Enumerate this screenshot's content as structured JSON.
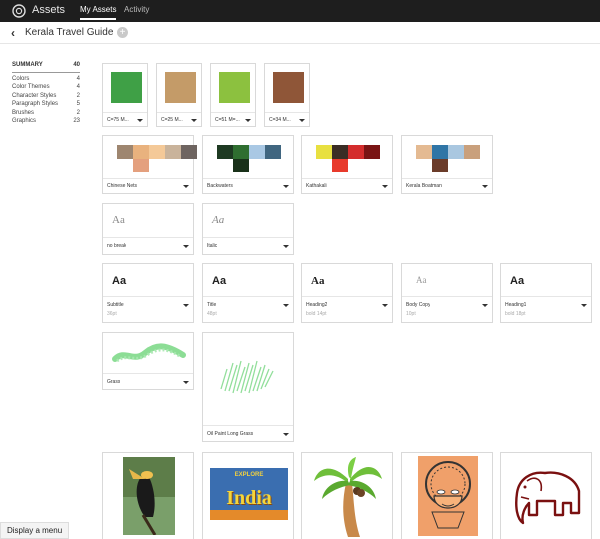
{
  "app": {
    "brand": "Assets",
    "nav_active": "My Assets",
    "nav_other": "Activity"
  },
  "library": {
    "title": "Kerala Travel Guide",
    "add_label": "+"
  },
  "sidebar": {
    "summary_label": "SUMMARY",
    "summary_count": "40",
    "items": [
      {
        "label": "Colors",
        "count": "4"
      },
      {
        "label": "Color Themes",
        "count": "4"
      },
      {
        "label": "Character Styles",
        "count": "2"
      },
      {
        "label": "Paragraph Styles",
        "count": "5"
      },
      {
        "label": "Brushes",
        "count": "2"
      },
      {
        "label": "Graphics",
        "count": "23"
      }
    ]
  },
  "colors": [
    {
      "label": "C=75 M...",
      "hex": "#3fa046"
    },
    {
      "label": "C=25 M...",
      "hex": "#c49b68"
    },
    {
      "label": "C=51 M=...",
      "hex": "#8cc13f"
    },
    {
      "label": "C=34 M...",
      "hex": "#8f5638"
    }
  ],
  "themes": [
    {
      "label": "Chinese Nets",
      "colors": [
        "#9e8670",
        "#e9b27e",
        "#f4c998",
        "#c9b39b",
        "#6e6460"
      ],
      "accent": "#e4a07e"
    },
    {
      "label": "Backwaters",
      "colors": [
        "#1e3a22",
        "#2f6e30",
        "#a9c8e4",
        "#406680"
      ],
      "accent": "#193119"
    },
    {
      "label": "Kathakali",
      "colors": [
        "#e8e040",
        "#3a2d25",
        "#d42d2d",
        "#7a1414"
      ],
      "accent": "#e83a2c"
    },
    {
      "label": "Kerala Boatman",
      "colors": [
        "#e4ba92",
        "#2f75a6",
        "#a9c7e0",
        "#c9a07c"
      ],
      "accent": "#6b3c2a"
    }
  ],
  "char_styles": [
    {
      "preview": "Aa",
      "label": "no break"
    },
    {
      "preview": "Aa",
      "label": "Italic"
    }
  ],
  "para_styles": [
    {
      "preview": "Aa",
      "label": "Subtitle",
      "sub": "36pt"
    },
    {
      "preview": "Aa",
      "label": "Title",
      "sub": "48pt"
    },
    {
      "preview": "Aa",
      "label": "Heading2",
      "sub": "bold  14pt"
    },
    {
      "preview": "Aa",
      "label": "Body Copy",
      "sub": "10pt"
    },
    {
      "preview": "Aa",
      "label": "Heading1",
      "sub": "bold  18pt"
    }
  ],
  "brushes": [
    {
      "label": "Grass"
    },
    {
      "label": "Oil Paint Long Grass"
    }
  ],
  "graphics": {
    "india_top": "EXPLORE",
    "india_text": "India"
  },
  "status_tooltip": "Display a menu"
}
